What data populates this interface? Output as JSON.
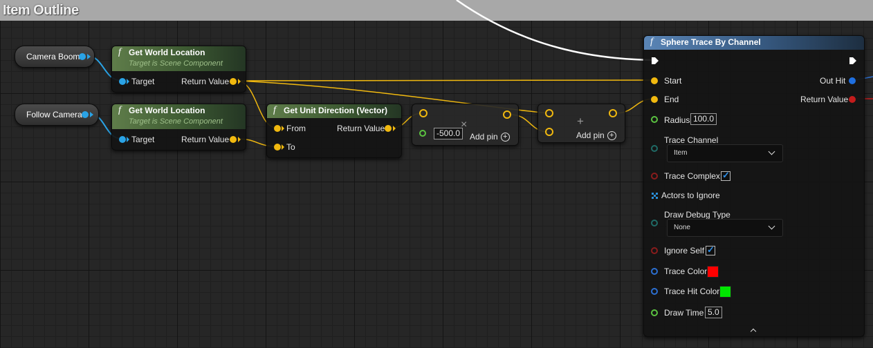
{
  "titlebar": {
    "title": "Item Outline"
  },
  "variables": {
    "camera_boom": "Camera Boom",
    "follow_camera": "Follow Camera"
  },
  "get_world_location_1": {
    "title": "Get World Location",
    "subtitle": "Target is Scene Component",
    "target": "Target",
    "return_value": "Return Value"
  },
  "get_world_location_2": {
    "title": "Get World Location",
    "subtitle": "Target is Scene Component",
    "target": "Target",
    "return_value": "Return Value"
  },
  "unit_direction": {
    "title": "Get Unit Direction (Vector)",
    "from": "From",
    "to": "To",
    "return_value": "Return Value"
  },
  "multiply_node": {
    "symbol": "×",
    "value": "-500.0",
    "add_pin": "Add pin"
  },
  "add_node": {
    "symbol": "+",
    "add_pin": "Add pin"
  },
  "sphere_trace": {
    "title": "Sphere Trace By Channel",
    "start": "Start",
    "end": "End",
    "radius_label": "Radius",
    "radius_value": "100.0",
    "trace_channel_label": "Trace Channel",
    "trace_channel_value": "Item",
    "trace_complex_label": "Trace Complex",
    "trace_complex_checked": true,
    "actors_to_ignore": "Actors to Ignore",
    "draw_debug_type_label": "Draw Debug Type",
    "draw_debug_type_value": "None",
    "ignore_self_label": "Ignore Self",
    "ignore_self_checked": true,
    "trace_color_label": "Trace Color",
    "trace_color": "#ff0000",
    "trace_hit_color_label": "Trace Hit Color",
    "trace_hit_color": "#00e600",
    "draw_time_label": "Draw Time",
    "draw_time_value": "5.0",
    "out_hit": "Out Hit",
    "return_value": "Return Value",
    "collapse_icon": "chevron-up-icon"
  },
  "colors": {
    "vector_pin": "#f1b90f",
    "object_pin": "#2aa3e6",
    "float_pin": "#5bc341",
    "bool_pin": "#8a1c1c",
    "struct_pin": "#2c6fd1",
    "pure_header": "#5f7d4a",
    "impure_header": "#5a85b6"
  }
}
